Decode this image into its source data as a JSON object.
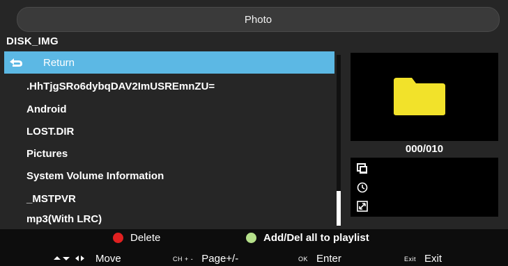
{
  "app": {
    "title": "Photo"
  },
  "path": "DISK_IMG",
  "file_list": {
    "return_label": "Return",
    "items": [
      ".HhTjgSRo6dybqDAV2ImUSREmnZU=",
      "Android",
      "LOST.DIR",
      "Pictures",
      "System Volume Information",
      "_MSTPVR",
      "mp3(With LRC)"
    ]
  },
  "preview": {
    "counter": "000/010",
    "icon": "folder-icon"
  },
  "info_icons": [
    "photo-size-icon",
    "clock-icon",
    "resize-icon"
  ],
  "legend": {
    "delete_label": "Delete",
    "playlist_label": "Add/Del all to playlist"
  },
  "hints": {
    "move_label": "Move",
    "page_key": "CH + -",
    "page_label": "Page+/-",
    "enter_key": "OK",
    "enter_label": "Enter",
    "exit_key": "Exit",
    "exit_label": "Exit"
  },
  "colors": {
    "selection": "#5cb8e4",
    "folder": "#f2e22a",
    "delete_dot": "#e02020",
    "playlist_dot": "#b5e08a"
  }
}
